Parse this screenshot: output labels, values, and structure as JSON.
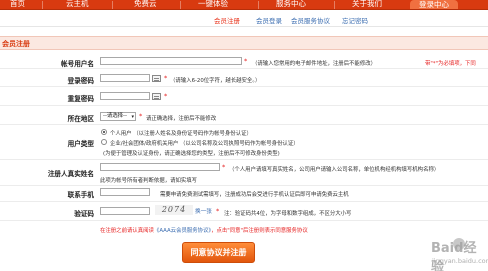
{
  "nav": {
    "items": [
      "首页",
      "云主机",
      "免费云",
      "一键体验",
      "服务中心",
      "关于我们"
    ],
    "active": "登录中心"
  },
  "subtabs": [
    "会员注册",
    "会员登录",
    "会员服务协议",
    "忘记密码"
  ],
  "section_title": "会员注册",
  "form": {
    "account": {
      "label": "帐号用户名",
      "hint": "（请输入您常用的电子邮件地址，注册后不能修改）",
      "hint_red": "带\"*\"为必填项，下同"
    },
    "password": {
      "label": "登录密码",
      "hint": "（请输入6-20位字符，越长越安全。）"
    },
    "password_confirm": {
      "label": "重复密码"
    },
    "region": {
      "label": "所在地区",
      "select_value": "--请选择--",
      "hint": "请正确选择，注册后不能修改"
    },
    "user_type": {
      "label": "用户类型",
      "personal": "个人用户 （以注册人姓名及身份证号码作为帐号身份认证）",
      "enterprise": "企业/社会团体/政府机关用户 （以公司名称及公司执照号码作为帐号身份认证）",
      "note": "(为便于管理及认证身份，请正确选择您的类型，注册后不可修改身份类型)"
    },
    "real_name": {
      "label": "注册人真实姓名",
      "hint": "（个人用户请填写真实姓名，公司用户请输入公司名称，单位机构经机构填写机构名称）",
      "hint2": "此项为帐号所有者判断依据，请如实填写"
    },
    "phone": {
      "label": "联系手机",
      "hint": "需要申请免费测试需填写，注册成功后会受进行手机认证后即可申请免费云主机"
    },
    "captcha": {
      "label": "验证码",
      "image_text": "2074",
      "refresh": "换一张",
      "hint": "注：验证码共4位，为字母和数字组成，不区分大小写"
    }
  },
  "agreement": {
    "prefix": "在注册之前请认真阅读",
    "link": "《AAA云会员服务协议》",
    "suffix": "，点击\"同意\"后注册则表示同意服务协议"
  },
  "submit_label": "同意协议并注册",
  "watermark": {
    "text": "Baid经验",
    "sub": "jingyan.baidu.com"
  }
}
